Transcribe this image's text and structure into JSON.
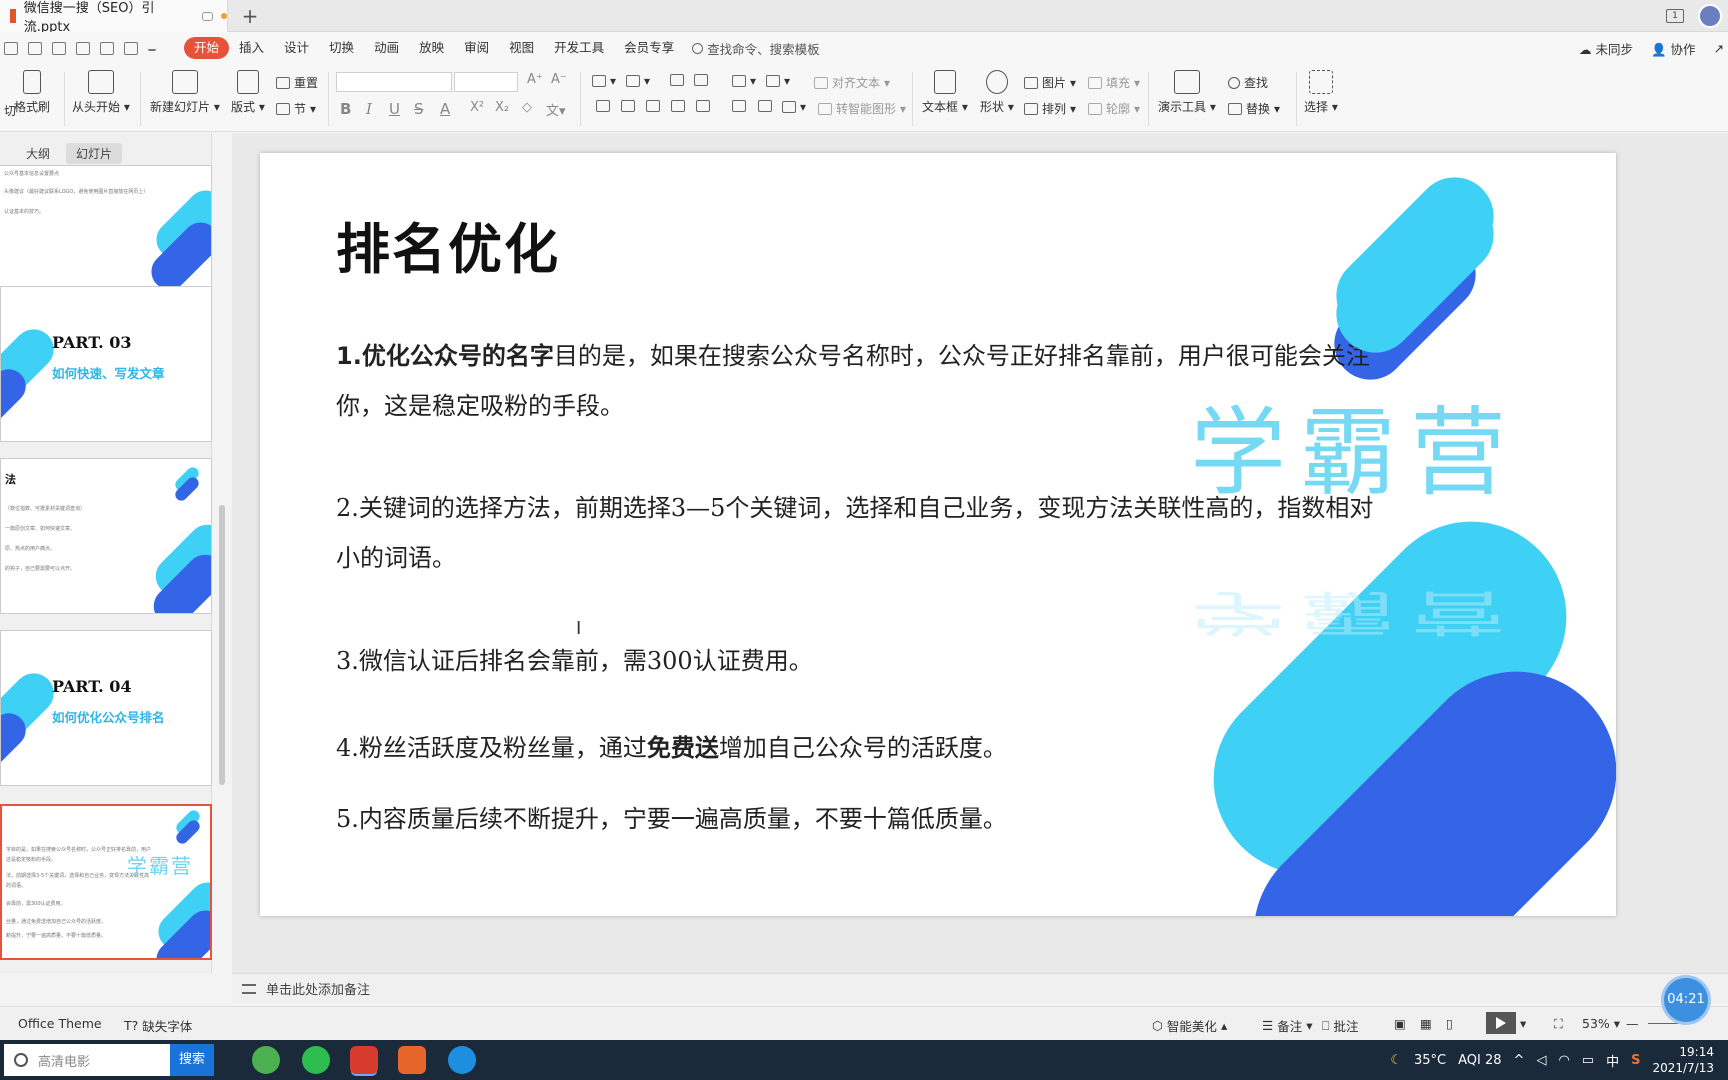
{
  "titlebar": {
    "doc_name": "微信搜一搜（SEO）引流.pptx",
    "new_tab": "+",
    "window_badge": "1"
  },
  "menu": {
    "items": [
      "开始",
      "插入",
      "设计",
      "切换",
      "动画",
      "放映",
      "审阅",
      "视图",
      "开发工具",
      "会员专享"
    ],
    "active": "开始",
    "search": "查找命令、搜索模板",
    "unsynced": "未同步",
    "collab": "协作"
  },
  "ribbon": {
    "cut": "剪切",
    "format_painter": "格式刷",
    "from_start": "从头开始",
    "new_slide": "新建幻灯片",
    "layout": "版式",
    "reset": "重置",
    "section": "节",
    "align_text": "对齐文本",
    "to_smartart": "转智能图形",
    "textbox": "文本框",
    "shape": "形状",
    "picture": "图片",
    "arrange": "排列",
    "fill": "填充",
    "outline": "轮廓",
    "present_tools": "演示工具",
    "find": "查找",
    "replace": "替换",
    "select": "选择",
    "bold": "B",
    "italic": "I",
    "underline": "U",
    "strike": "S",
    "font_color": "A",
    "superscript": "X²",
    "subscript": "X₂",
    "grow_font": "A⁺",
    "shrink_font": "A⁻"
  },
  "panel": {
    "tab_outline": "大纲",
    "tab_slides": "幻灯片",
    "add": "+",
    "thumbs": [
      {
        "part": "",
        "sub": "",
        "lines": [
          "公众号基本信息设置要点",
          "头像建议（最好建议联系LOGO，避免使用图片直接放在网页上）",
          "认证基本的技巧。"
        ]
      },
      {
        "part": "PART. 03",
        "sub": "如何快速、写发文章",
        "lines": []
      },
      {
        "part": "法",
        "sub": "",
        "lines": [
          "（数位指数、可按素材关键词查询）",
          "一篇原创文章、如何快速文章。",
          "原、热点的用户痛点。",
          "的钩子，自己要需要可以点开。"
        ]
      },
      {
        "part": "PART. 04",
        "sub": "如何优化公众号排名",
        "lines": []
      },
      {
        "part": "",
        "sub": "",
        "logo": "学霸营",
        "lines": [
          "字目的是，如果在搜索公众号名称时，公众号正好排名靠前，用户",
          "这是稳定吸粉的手段。",
          "法，前期选择3-5个关键词，选择和自己业务，变现方法关联性高",
          "的词语。",
          "会靠前，需300认证费用。",
          "丝量，通过免费送增加自己公众号的活跃度。",
          "断提升，宁要一遍高质量，不要十篇低质量。"
        ]
      }
    ]
  },
  "slide": {
    "title": "排名优化",
    "watermark": "学霸营",
    "p1_bold": "1.优化公众号的名字",
    "p1_rest": "目的是，如果在搜索公众号名称时，公众号正好排名靠前，用户很可能会关注你，这是稳定吸粉的手段。",
    "p2": "2.关键词的选择方法，前期选择3—5个关键词，选择和自己业务，变现方法关联性高的，指数相对小的词语。",
    "p3": "3.微信认证后排名会靠前，需300认证费用。",
    "p4_a": "4.粉丝活跃度及粉丝量，通过",
    "p4_bold": "免费送",
    "p4_b": "增加自己公众号的活跃度。",
    "p5": "5.内容质量后续不断提升，宁要一遍高质量，不要十篇低质量。"
  },
  "notes": {
    "placeholder": "单击此处添加备注"
  },
  "statusbar": {
    "theme": "Office Theme",
    "missing_font": "缺失字体",
    "beautify": "智能美化",
    "notes": "备注",
    "comments": "批注",
    "zoom": "53%",
    "timer": "04:21",
    "minus": "—"
  },
  "taskbar": {
    "search_placeholder": "高清电影",
    "search_button": "搜索",
    "weather": "35°C",
    "aqi": "AQI 28",
    "ime": "中",
    "time": "19:14",
    "date": "2021/7/13"
  },
  "colors": {
    "accent": "#e6533a",
    "cyan": "#3fd0f5",
    "blue": "#3365e6"
  }
}
